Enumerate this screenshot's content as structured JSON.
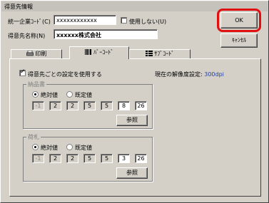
{
  "window": {
    "title": "得意先情報"
  },
  "form": {
    "company_code_label": "統一企業ｺｰﾄﾞ(C)",
    "company_code_value": "xxxxxxxxxxxx",
    "not_used_label": "使用しない(U)",
    "customer_name_label": "得意先名称(N)",
    "customer_name_value": "xxxxxx株式会社"
  },
  "buttons": {
    "ok": "OK",
    "cancel": "ｷｬﾝｾﾙ"
  },
  "tabs": [
    {
      "label": "印刷",
      "icon": "printer-icon"
    },
    {
      "label": "ﾊﾞｰｺｰﾄﾞ",
      "icon": "barcode-icon"
    },
    {
      "label": "ｻﾌﾞｺｰﾄﾞ",
      "icon": "grid-icon"
    }
  ],
  "barcode_tab": {
    "use_customer_settings_label": "得意先ごとの設定を使用する",
    "current_resolution_label": "現在の解像度設定: ",
    "current_resolution_value": "300dpi",
    "groups": [
      {
        "title": "納品書",
        "absolute_label": "絶対値",
        "default_label": "既定値",
        "values": [
          "-1",
          "2",
          "2",
          "5",
          "5",
          "8",
          "26"
        ],
        "browse_label": "参照"
      },
      {
        "title": "荷札",
        "absolute_label": "絶対値",
        "default_label": "既定値",
        "values": [
          "-1",
          "2",
          "2",
          "5",
          "5",
          "3",
          "26"
        ],
        "browse_label": "参照"
      }
    ]
  },
  "colors": {
    "highlight": "#e01010",
    "resolution": "#2040a0"
  }
}
